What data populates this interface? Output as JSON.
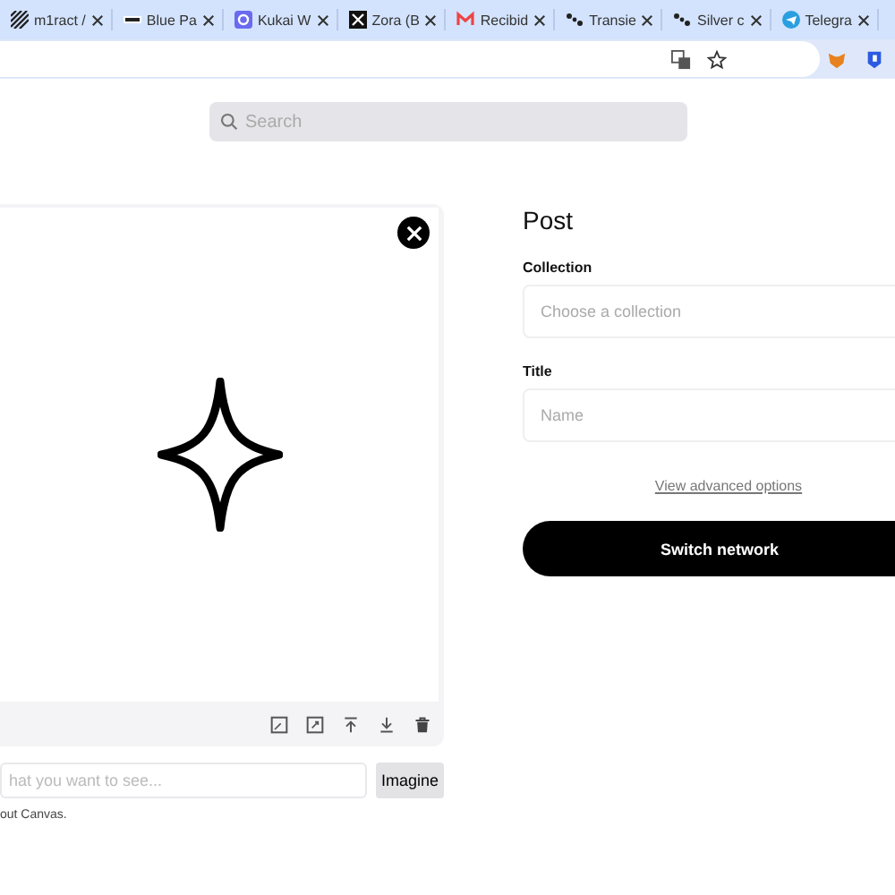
{
  "browser": {
    "tabs": [
      {
        "title": "m1ract /"
      },
      {
        "title": "Blue Pa"
      },
      {
        "title": "Kukai W"
      },
      {
        "title": "Zora (B"
      },
      {
        "title": "Recibid"
      },
      {
        "title": "Transie"
      },
      {
        "title": "Silver c"
      },
      {
        "title": "Telegra"
      }
    ]
  },
  "search": {
    "placeholder": "Search"
  },
  "canvas": {
    "prompt_placeholder": "hat you want to see...",
    "imagine_button": "Imagine",
    "footnote": "out Canvas."
  },
  "post": {
    "title": "Post",
    "collection_label": "Collection",
    "collection_placeholder": "Choose a collection",
    "title_label": "Title",
    "title_placeholder": "Name",
    "advanced_link": "View advanced options",
    "submit_button": "Switch network"
  }
}
